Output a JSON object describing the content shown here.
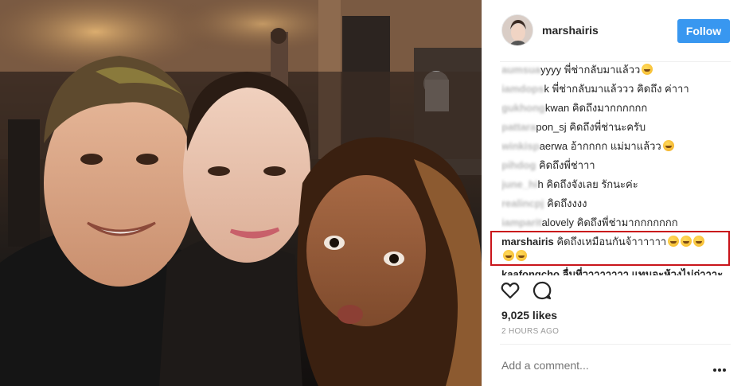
{
  "post": {
    "username": "marshairis",
    "follow_label": "Follow",
    "likes": "9,025 likes",
    "timestamp": "2 HOURS AGO",
    "comment_placeholder": "Add a comment..."
  },
  "comments": [
    {
      "user": "aumsua",
      "text": "yyyy พี่ช่ากลับมาแล้วว",
      "emoji": "heart-eyes",
      "user_blurred": true
    },
    {
      "user": "iamdops",
      "text": "k พี่ช่ากลับมาแล้ววว คิดถึง ค่าาา",
      "emoji": "",
      "user_blurred": true
    },
    {
      "user": "gukhong",
      "text": "kwan คิดถึงมากกกกกก",
      "emoji": "",
      "user_blurred": true
    },
    {
      "user": "pattara",
      "text": "pon_sj คิดถึงพี่ช่านะครับ",
      "emoji": "",
      "user_blurred": true
    },
    {
      "user": "winkisp",
      "text": "aerwa อ้ากกกก แม่มาแล้วว",
      "emoji": "crying",
      "user_blurred": true
    },
    {
      "user": "pihdog",
      "text": "คิดถึงพี่ช่าาา",
      "emoji": "",
      "user_blurred": true
    },
    {
      "user": "june_hi",
      "text": "h คิดถึงจังเลย รักนะค่ะ",
      "emoji": "",
      "user_blurred": true
    },
    {
      "user": "realincpj",
      "text": "คิดถึงงงง",
      "emoji": "",
      "user_blurred": true
    },
    {
      "user": "iamparit",
      "text": "alovely คิดถึงพี่ช่ามากกกกกกก",
      "emoji": "",
      "user_blurred": true
    },
    {
      "user": "marshairis",
      "text": "คิดถึงเหมือนกันจ้าาาาาา",
      "emoji": "grinning x5",
      "user_blurred": false
    }
  ],
  "cut_comment": "kaafongcho ลื่มที่วาาาาาาา แทนจะห้วงไม่ก่าาาะ",
  "icons": {
    "like": "heart-icon",
    "comment": "speech-bubble-icon",
    "more": "more-options-icon"
  },
  "colors": {
    "follow_button": "#3897f0",
    "highlight_border": "#c9151b",
    "timestamp": "#999999"
  }
}
